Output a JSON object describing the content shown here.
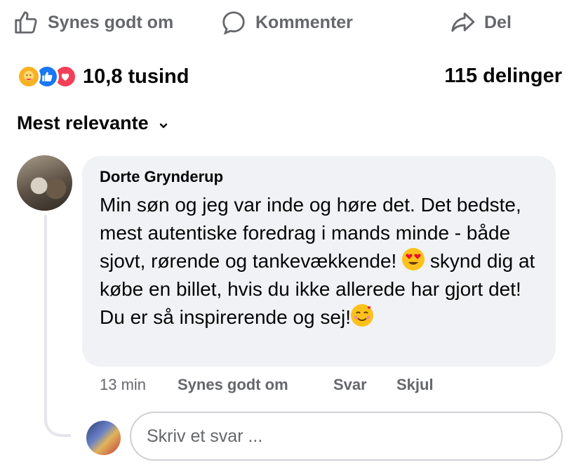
{
  "actions": {
    "like": "Synes godt om",
    "comment": "Kommenter",
    "share": "Del"
  },
  "reactions": {
    "count": "10,8 tusind",
    "shares": "115 delinger",
    "types": [
      "care",
      "like",
      "love"
    ]
  },
  "sort": {
    "label": "Mest relevante"
  },
  "comment": {
    "author": "Dorte Grynderup",
    "text_part1": "Min søn og jeg var inde og høre det. Det bedste, mest autentiske foredrag i mands minde - både sjovt, rørende og tankevækkende! ",
    "text_part2": " skynd dig at købe en billet, hvis du ikke allerede har gjort det! Du er så inspirerende og sej!",
    "time": "13 min",
    "like_label": "Synes godt om",
    "reply_label": "Svar",
    "hide_label": "Skjul"
  },
  "reply_box": {
    "placeholder": "Skriv et svar ..."
  },
  "colors": {
    "muted_text": "#65676b",
    "bubble_bg": "#f0f2f5",
    "like_blue": "#1877f2",
    "love_red": "#f33e58",
    "care_yellow": "#f7b125"
  }
}
